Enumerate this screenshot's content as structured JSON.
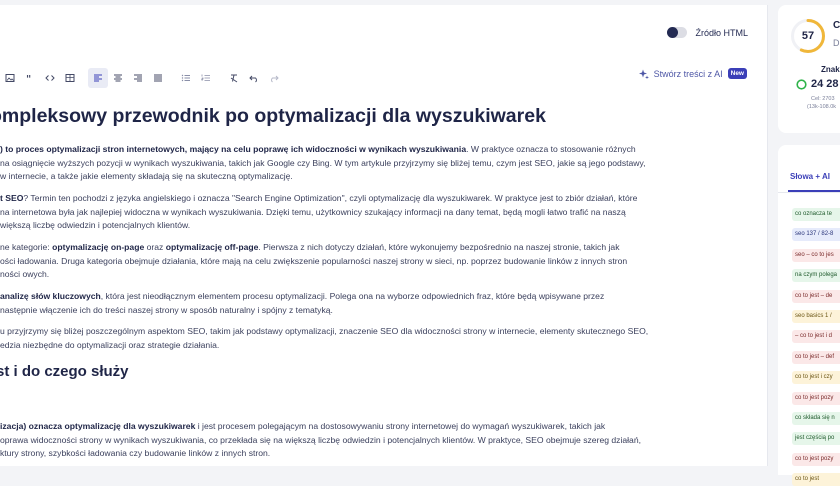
{
  "topbar": {
    "html_source_label": "Źródło HTML"
  },
  "toolbar": {
    "ai_create_label": "Stwórz treści z AI",
    "ai_new_badge": "New"
  },
  "article": {
    "title": "ompleksowy przewodnik po optymalizacji dla wyszukiwarek",
    "p1": [
      {
        "b": ") to proces optymalizacji stron internetowych, mający na celu poprawę ich widoczności w wynikach wyszukiwania",
        "t": ". W praktyce oznacza to stosowanie różnych"
      },
      {
        "t": "na osiągnięcie wyższych pozycji w wynikach wyszukiwania, takich jak Google czy Bing. W tym artykule przyjrzymy się bliżej temu, czym jest SEO, jakie są jego podstawy,"
      },
      {
        "t": "w internecie, a także jakie elementy składają się na skuteczną optymalizację."
      }
    ],
    "p2": [
      {
        "b": "t SEO",
        "t": "? Termin ten pochodzi z języka angielskiego i oznacza \"Search Engine Optimization\", czyli optymalizację dla wyszukiwarek. W praktyce jest to zbiór działań, które"
      },
      {
        "t": "na internetowa była jak najlepiej widoczna w wynikach wyszukiwania. Dzięki temu, użytkownicy szukający informacji na dany temat, będą mogli łatwo trafić na naszą"
      },
      {
        "t": "większą liczbę odwiedzin i potencjalnych klientów."
      }
    ],
    "p3": [
      {
        "t": "ne kategorie: ",
        "b": "optymalizację on-page",
        "t2": " oraz ",
        "b2": "optymalizację off-page",
        "t3": ". Pierwsza z nich dotyczy działań, które wykonujemy bezpośrednio na naszej stronie, takich jak"
      },
      {
        "t": "ości ładowania. Druga kategoria obejmuje działania, które mają na celu zwiększenie popularności naszej strony w sieci, np. poprzez budowanie linków z innych stron"
      },
      {
        "t": "ności owych."
      }
    ],
    "p4": [
      {
        "b": "analizę słów kluczowych",
        "t": ", która jest nieodłącznym elementem procesu optymalizacji. Polega ona na wyborze odpowiednich fraz, które będą wpisywane przez"
      },
      {
        "t": "następnie włączenie ich do treści naszej strony w sposób naturalny i spójny z tematyką."
      }
    ],
    "p5": [
      {
        "t": "u przyjrzymy się bliżej poszczególnym aspektom SEO, takim jak podstawy optymalizacji, znaczenie SEO dla widoczności strony w internecie, elementy skutecznego SEO,"
      },
      {
        "t": "edzia niezbędne do optymalizacji oraz strategie działania."
      }
    ],
    "h2": "st i do czego służy",
    "p6": [
      {
        "b": "izacja) oznacza optymalizację dla wyszukiwarek",
        "t": " i jest procesem polegającym na dostosowywaniu strony internetowej do wymagań wyszukiwarek, takich jak"
      },
      {
        "t": "oprawa widoczności strony w wynikach wyszukiwania, co przekłada się na większą liczbę odwiedzin i potencjalnych klientów. W praktyce, SEO obejmuje szereg działań,"
      },
      {
        "t": "ktury strony, szybkości ładowania czy budowanie linków z innych stron."
      }
    ]
  },
  "score": {
    "value": "57",
    "letter_c": "C",
    "letter_d": "D",
    "znaki_label": "Znak",
    "count": "24 28",
    "cel": "Cel: 2703",
    "range": "(13k-108.0k"
  },
  "words_panel": {
    "tab_label": "Słowa + AI",
    "keywords": [
      {
        "text": "co oznacza te",
        "color": "green"
      },
      {
        "text": "seo  137 / 82-8",
        "color": "blue"
      },
      {
        "text": "seo – co to jes",
        "color": "red"
      },
      {
        "text": "na czym polega",
        "color": "green"
      },
      {
        "text": "co to jest – de",
        "color": "red"
      },
      {
        "text": "seo basics  1 /",
        "color": "yellow"
      },
      {
        "text": "– co to jest i d",
        "color": "red"
      },
      {
        "text": "co to jest – def",
        "color": "red"
      },
      {
        "text": "co to jest i czy",
        "color": "yellow"
      },
      {
        "text": "co to jest pozy",
        "color": "red"
      },
      {
        "text": "co składa się n",
        "color": "green"
      },
      {
        "text": "jest częścią po",
        "color": "green"
      },
      {
        "text": "co to jest pozy",
        "color": "red"
      },
      {
        "text": "co to jest",
        "color": "yellow"
      }
    ]
  }
}
